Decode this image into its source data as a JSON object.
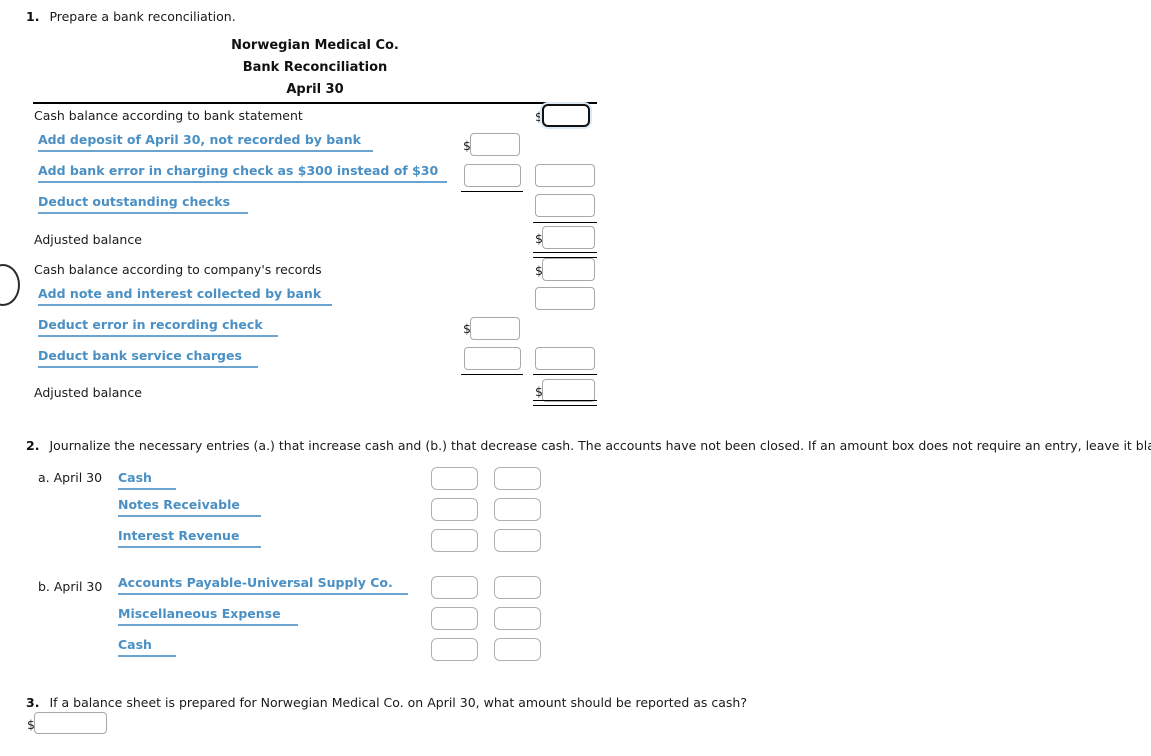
{
  "questions": {
    "q1": {
      "number": "1.",
      "text": "Prepare a bank reconciliation."
    },
    "q2": {
      "number": "2.",
      "text": "Journalize the necessary entries (a.) that increase cash and (b.) that decrease cash. The accounts have not been closed. If an amount box does not require an entry, leave it blank."
    },
    "q3": {
      "number": "3.",
      "text": "If a balance sheet is prepared for Norwegian Medical Co. on April 30, what amount should be reported as cash?"
    }
  },
  "statement": {
    "company": "Norwegian Medical Co.",
    "title": "Bank Reconciliation",
    "date": "April 30",
    "bank_section": {
      "opening_label": "Cash balance according to bank statement",
      "adjustments": [
        "Add deposit of April 30, not recorded by bank",
        "Add bank error in charging check as $300 instead of $30",
        "Deduct outstanding checks"
      ],
      "adjusted_label": "Adjusted balance"
    },
    "company_section": {
      "opening_label": "Cash balance according to company's records",
      "adjustments": [
        "Add note and interest collected by bank",
        "Deduct error in recording check",
        "Deduct bank service charges"
      ],
      "adjusted_label": "Adjusted balance"
    }
  },
  "journal": {
    "entries": [
      {
        "ref": "a.",
        "date": "April 30",
        "date_label": "a. April 30",
        "accounts": [
          "Cash",
          "Notes Receivable",
          "Interest Revenue"
        ]
      },
      {
        "ref": "b.",
        "date": "April 30",
        "date_label": "b. April 30",
        "accounts": [
          "Accounts Payable-Universal Supply Co.",
          "Miscellaneous Expense",
          "Cash"
        ]
      }
    ]
  },
  "symbols": {
    "dollar": "$"
  },
  "inputs": {
    "bank_opening": "",
    "bank_adj_1": "",
    "bank_adj_2_col1": "",
    "bank_adj_2_col2": "",
    "bank_adj_3": "",
    "bank_adjusted": "",
    "company_opening": "",
    "company_adj_1": "",
    "company_adj_2_col1": "",
    "company_adj_3_col1": "",
    "company_adj_3_col2": "",
    "company_adjusted": "",
    "journal_a": [
      {
        "debit": "",
        "credit": ""
      },
      {
        "debit": "",
        "credit": ""
      },
      {
        "debit": "",
        "credit": ""
      }
    ],
    "journal_b": [
      {
        "debit": "",
        "credit": ""
      },
      {
        "debit": "",
        "credit": ""
      },
      {
        "debit": "",
        "credit": ""
      }
    ],
    "q3_answer": ""
  },
  "colors": {
    "account_link": "#4a90c4",
    "account_underline": "#6aa4cf",
    "text": "#1a1a1a",
    "rule": "#000000",
    "box_border": "#a8a8a8",
    "focus_border": "#111111",
    "focus_glow": "#dce9f5"
  }
}
